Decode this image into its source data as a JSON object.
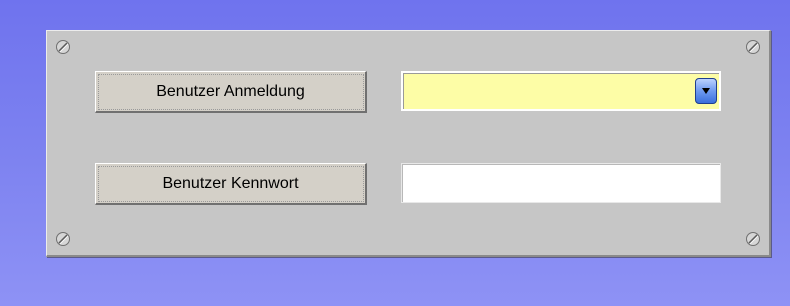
{
  "form": {
    "login_label": "Benutzer Anmeldung",
    "password_label": "Benutzer Kennwort",
    "login_value": "",
    "password_value": ""
  },
  "icons": {
    "corner": "screw-icon",
    "dropdown": "chevron-down-icon"
  },
  "colors": {
    "background": "#7479ef",
    "panel": "#c6c6c6",
    "combo_fill": "#fdfda6",
    "dropdown_button": "#4f80e8"
  }
}
